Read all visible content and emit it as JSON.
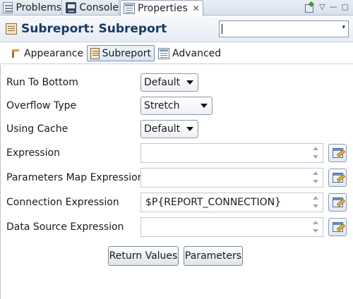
{
  "view_tabs": [
    {
      "label": "Problems",
      "icon": "problems-icon"
    },
    {
      "label": "Console",
      "icon": "console-icon"
    },
    {
      "label": "Properties",
      "icon": "properties-icon",
      "active": true
    }
  ],
  "view_tools": {
    "menu_glyph": "▽",
    "minimize_glyph": "—",
    "maximize_glyph": "▢"
  },
  "header": {
    "title": "Subreport: Subreport",
    "combo_value": ""
  },
  "section_tabs": [
    {
      "label": "Appearance"
    },
    {
      "label": "Subreport",
      "selected": true
    },
    {
      "label": "Advanced"
    }
  ],
  "form": {
    "run_to_bottom": {
      "label": "Run To Bottom",
      "value": "Default"
    },
    "overflow_type": {
      "label": "Overflow Type",
      "value": "Stretch"
    },
    "using_cache": {
      "label": "Using Cache",
      "value": "Default"
    },
    "expression": {
      "label": "Expression",
      "value": ""
    },
    "parameters_map_expression": {
      "label": "Parameters Map Expression",
      "value": ""
    },
    "connection_expression": {
      "label": "Connection Expression",
      "value": "$P{REPORT_CONNECTION}"
    },
    "data_source_expression": {
      "label": "Data Source Expression",
      "value": ""
    }
  },
  "buttons": {
    "return_values": "Return Values",
    "parameters": "Parameters"
  },
  "colors": {
    "title": "#1b3a66",
    "tab_bar": "#d9e1ec",
    "selected_tab_border": "#6d8fbe"
  }
}
